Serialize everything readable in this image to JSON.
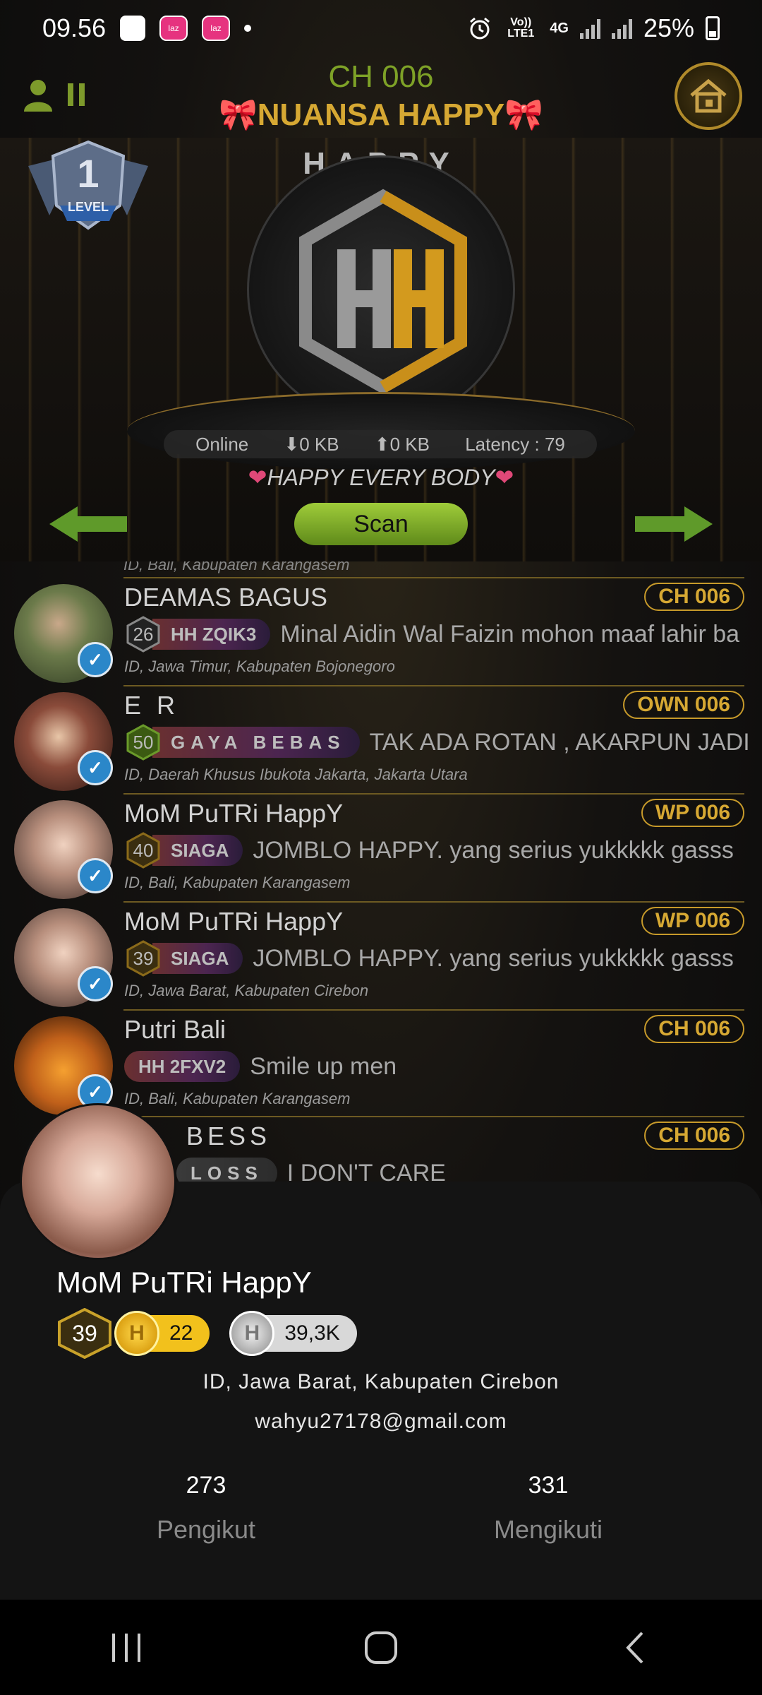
{
  "status_bar": {
    "time": "09.56",
    "network_label": "Vo)) LTE1",
    "network_type": "4G",
    "battery": "25%"
  },
  "header": {
    "channel": "CH 006",
    "room_name": "🎀NUANSA HAPPY🎀",
    "level_number": "1",
    "level_label": "LEVEL"
  },
  "stage": {
    "brand_word": "HAPPY",
    "stats": {
      "online_label": "Online",
      "download": "0 KB",
      "upload": "0 KB",
      "latency_label": "Latency :",
      "latency_value": "79"
    },
    "tagline": "HAPPY EVERY BODY",
    "scan_label": "Scan"
  },
  "member_list": {
    "cut_location": "ID, Bali, Kabupaten Karangasem",
    "members": [
      {
        "name": "DEAMAS BAGUS",
        "channel": "CH 006",
        "level": "26",
        "tag": "HH  ZQIK3",
        "message": "Minal Aidin Wal Faizin mohon maaf lahir ba",
        "location": "ID, Jawa Timur, Kabupaten Bojonegoro"
      },
      {
        "name": "E R",
        "channel": "OWN 006",
        "level": "50",
        "tag": "GAYA BEBAS",
        "message": "TAK ADA ROTAN , AKARPUN JADI",
        "location": "ID, Daerah Khusus Ibukota Jakarta, Jakarta Utara"
      },
      {
        "name": "MoM PuTRi HappY",
        "channel": "WP 006",
        "level": "40",
        "tag": "SIAGA",
        "message": "JOMBLO HAPPY. yang serius yukkkkk gasss",
        "location": "ID, Bali, Kabupaten Karangasem"
      },
      {
        "name": "MoM PuTRi HappY",
        "channel": "WP 006",
        "level": "39",
        "tag": "SIAGA",
        "message": "JOMBLO HAPPY. yang serius yukkkkk gasss",
        "location": "ID, Jawa Barat, Kabupaten Cirebon"
      },
      {
        "name": "Putri Bali",
        "channel": "CH 006",
        "level": "",
        "tag": "HH  2FXV2",
        "message": "Smile up men",
        "location": "ID, Bali, Kabupaten Karangasem"
      },
      {
        "name": "BESS",
        "channel": "CH 006",
        "level": "",
        "tag": "LOSS",
        "message": "I DON'T CARE",
        "location": ""
      }
    ]
  },
  "profile": {
    "name": "MoM PuTRi HappY",
    "level": "39",
    "gold_coins": "22",
    "silver_coins": "39,3K",
    "location": "ID, Jawa Barat, Kabupaten Cirebon",
    "email": "wahyu27178@gmail.com",
    "followers_count": "273",
    "followers_label": "Pengikut",
    "following_count": "331",
    "following_label": "Mengikuti"
  },
  "colors": {
    "accent_gold": "#d6a833",
    "accent_green": "#7ea227",
    "verified_blue": "#2b87c9"
  }
}
